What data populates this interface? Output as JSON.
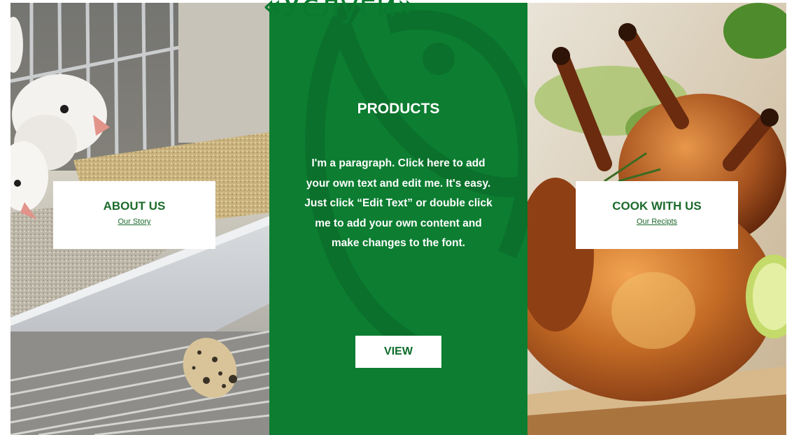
{
  "page": {
    "title": "«Услуги»"
  },
  "about": {
    "title": "ABOUT US",
    "link": "Our Story",
    "image": "quail-cage-photo"
  },
  "products": {
    "title": "PRODUCTS",
    "paragraph": "I'm a paragraph. Click here to add your own text and edit me. It's easy. Just click “Edit Text” or double click me to add your own content and make changes to the font.",
    "button_label": "VIEW",
    "background_color": "#0c7d31",
    "watermark": "leaf-logo-watermark"
  },
  "cook": {
    "title": "COOK WITH US",
    "link": "Our Recipts",
    "image": "roasted-quail-photo"
  }
}
